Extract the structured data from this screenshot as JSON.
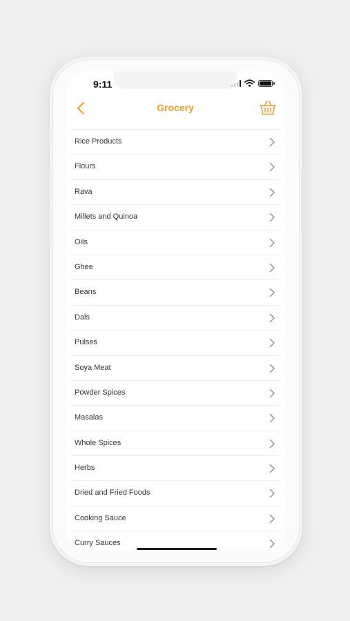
{
  "status_bar": {
    "time": "9:11"
  },
  "nav": {
    "title": "Grocery"
  },
  "colors": {
    "accent": "#f39a2a",
    "text": "#333333",
    "divider": "#ececec",
    "chevron": "#8a8a8a"
  },
  "icons": {
    "back": "chevron-left-icon",
    "cart": "basket-icon",
    "row": "chevron-right-icon"
  },
  "categories": [
    "Rice Products",
    "Flours",
    "Rava",
    "Millets and Quinoa",
    "Oils",
    "Ghee",
    "Beans",
    "Dals",
    "Pulses",
    "Soya Meat",
    "Powder Spices",
    "Masalas",
    "Whole Spices",
    "Herbs",
    "Dried and Fried Foods",
    "Cooking Sauce",
    "Curry Sauces"
  ]
}
